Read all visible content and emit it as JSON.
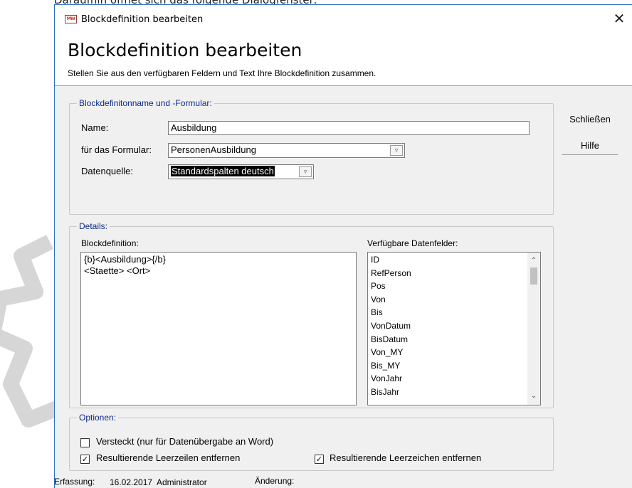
{
  "background": {
    "caption": "Daraufhin öffnet sich das folgende Dialogfenster:"
  },
  "window": {
    "title": "Blockdefinition bearbeiten",
    "app_icon_text": "MW",
    "close_glyph": "✕"
  },
  "header": {
    "title": "Blockdefinition bearbeiten",
    "subtitle": "Stellen Sie aus den verfügbaren Feldern und Text Ihre Blockdefinition zusammen."
  },
  "group_name": {
    "legend": "Blockdefinitonname und -Formular:",
    "name_label": "Name:",
    "name_value": "Ausbildung",
    "formular_label": "für das Formular:",
    "formular_value": "PersonenAusbildung",
    "datenquelle_label": "Datenquelle:",
    "datenquelle_value": "Standardspalten deutsch"
  },
  "buttons": {
    "close_label": "Schließen",
    "help_label": "Hilfe"
  },
  "group_details": {
    "legend": "Details:",
    "blockdef_label": "Blockdefinition:",
    "blockdef_lines": [
      "{b}<Ausbildung>{/b}",
      "<Staette> <Ort>"
    ],
    "fields_label": "Verfügbare Datenfelder:",
    "fields": [
      "ID",
      "RefPerson",
      "Pos",
      "Von",
      "Bis",
      "VonDatum",
      "BisDatum",
      "Von_MY",
      "Bis_MY",
      "VonJahr",
      "BisJahr"
    ]
  },
  "group_options": {
    "legend": "Optionen:",
    "opt_hidden": {
      "label": "Versteckt (nur für Datenübergabe an Word)",
      "checked": false
    },
    "opt_remove_lines": {
      "label": "Resultierende Leerzeilen entfernen",
      "checked": true
    },
    "opt_remove_spaces": {
      "label": "Resultierende Leerzeichen entfernen",
      "checked": true
    }
  },
  "footer": {
    "erfassung_label": "Erfassung:",
    "erfassung_date": "16.02.2017",
    "erfassung_user": "Administrator",
    "aenderung_label": "Änderung:"
  }
}
